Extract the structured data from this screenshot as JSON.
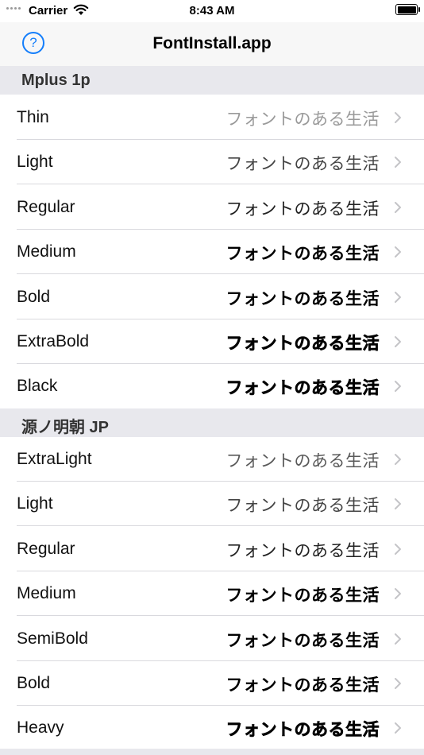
{
  "status_bar": {
    "carrier": "Carrier",
    "time": "8:43 AM"
  },
  "nav": {
    "title": "FontInstall.app",
    "help_label": "?"
  },
  "sections": [
    {
      "title": "Mplus 1p",
      "rows": [
        {
          "name": "Thin",
          "sample": "フォントのある生活",
          "weight": "100"
        },
        {
          "name": "Light",
          "sample": "フォントのある生活",
          "weight": "300"
        },
        {
          "name": "Regular",
          "sample": "フォントのある生活",
          "weight": "400"
        },
        {
          "name": "Medium",
          "sample": "フォントのある生活",
          "weight": "500"
        },
        {
          "name": "Bold",
          "sample": "フォントのある生活",
          "weight": "700"
        },
        {
          "name": "ExtraBold",
          "sample": "フォントのある生活",
          "weight": "800"
        },
        {
          "name": "Black",
          "sample": "フォントのある生活",
          "weight": "900"
        }
      ]
    },
    {
      "title": "源ノ明朝 JP",
      "rows": [
        {
          "name": "ExtraLight",
          "sample": "フォントのある生活",
          "weight": "200"
        },
        {
          "name": "Light",
          "sample": "フォントのある生活",
          "weight": "300"
        },
        {
          "name": "Regular",
          "sample": "フォントのある生活",
          "weight": "400"
        },
        {
          "name": "Medium",
          "sample": "フォントのある生活",
          "weight": "500"
        },
        {
          "name": "SemiBold",
          "sample": "フォントのある生活",
          "weight": "600"
        },
        {
          "name": "Bold",
          "sample": "フォントのある生活",
          "weight": "700"
        },
        {
          "name": "Heavy",
          "sample": "フォントのある生活",
          "weight": "900"
        }
      ]
    }
  ],
  "colors": {
    "tint": "#147efb",
    "section_bg": "#e8e8ed",
    "chevron": "#c4c4c7"
  },
  "icons": {
    "help": "question-circle-icon",
    "chevron": "chevron-right-icon",
    "wifi": "wifi-icon",
    "battery": "battery-icon"
  }
}
